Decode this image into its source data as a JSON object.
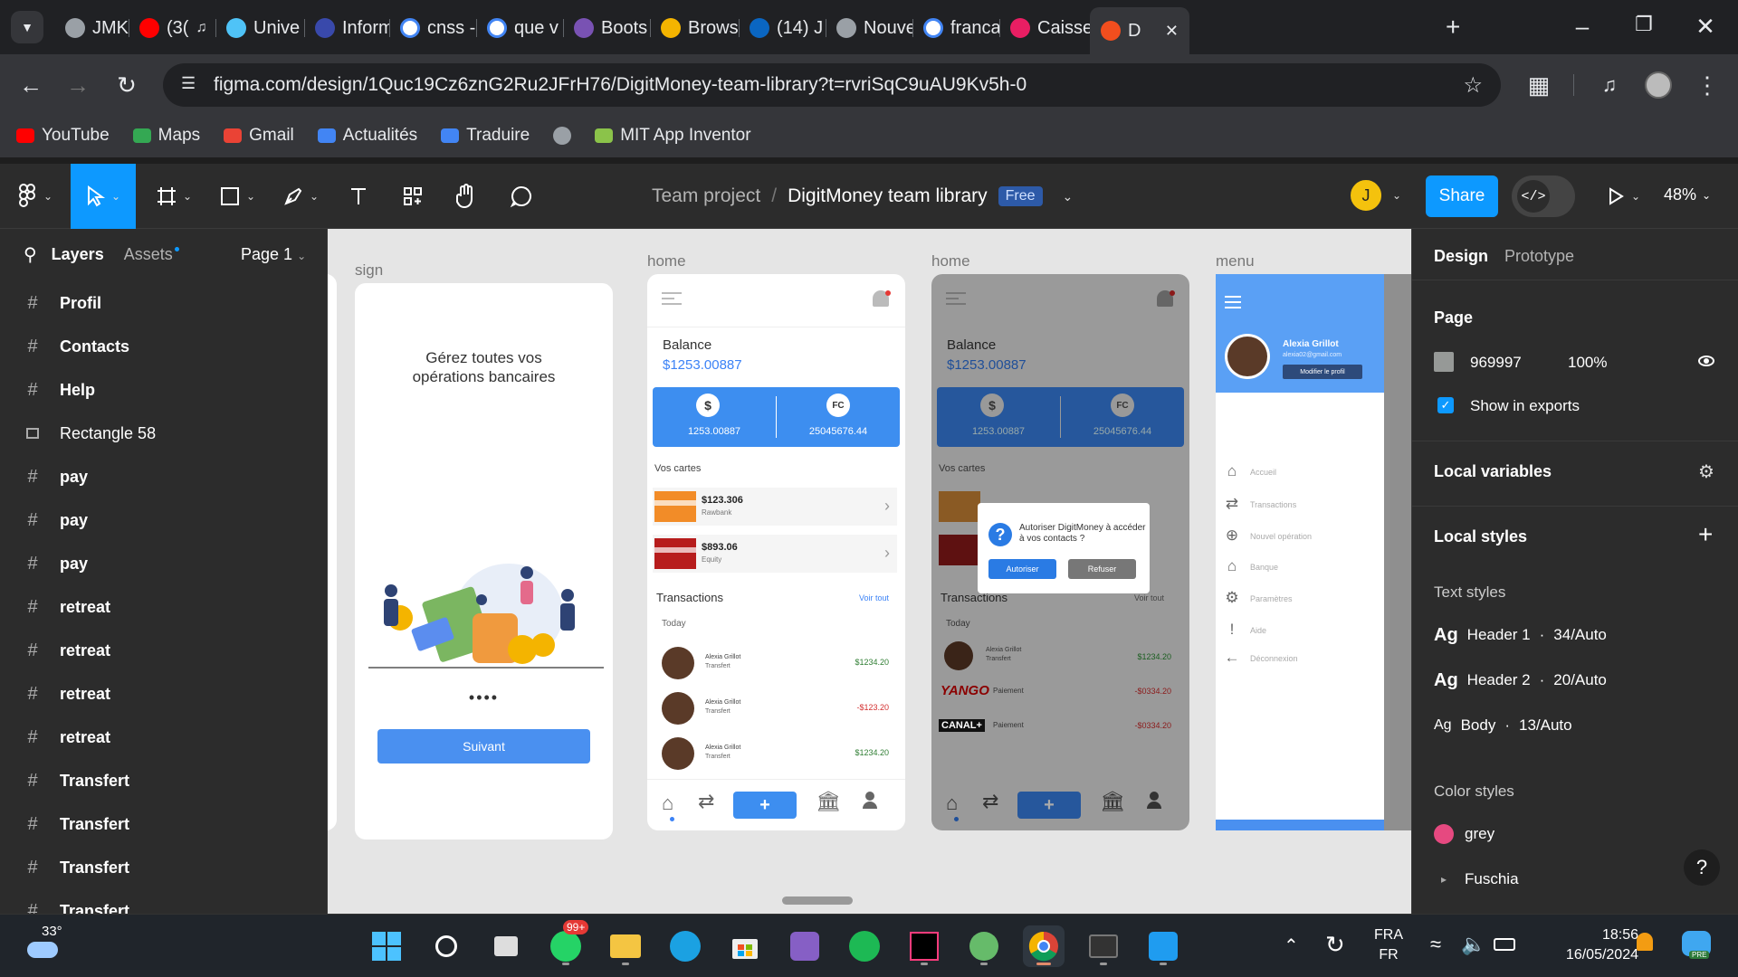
{
  "browser": {
    "tabs": [
      {
        "label": "JMK -",
        "icon": "globe-icon",
        "color": "#9aa0a6"
      },
      {
        "label": "(3(",
        "icon": "youtube-icon",
        "color": "#ff0000",
        "audio": true
      },
      {
        "label": "Unive",
        "icon": "globe-icon",
        "color": "#4fc3f7"
      },
      {
        "label": "Inform",
        "icon": "ze-icon",
        "color": "#3949ab"
      },
      {
        "label": "cnss -",
        "icon": "google-icon",
        "color": "#ffffff"
      },
      {
        "label": "que v",
        "icon": "google-icon",
        "color": "#ffffff"
      },
      {
        "label": "Boots",
        "icon": "bootstrap-icon",
        "color": "#7952b3"
      },
      {
        "label": "Brows",
        "icon": "browserstack-icon",
        "color": "#f4b400"
      },
      {
        "label": "(14) J",
        "icon": "linkedin-icon",
        "color": "#0a66c2"
      },
      {
        "label": "Nouve",
        "icon": "globe-icon",
        "color": "#9aa0a6"
      },
      {
        "label": "franca",
        "icon": "google-icon",
        "color": "#ffffff"
      },
      {
        "label": "Caisse",
        "icon": "app-icon",
        "color": "#e91e63"
      },
      {
        "label": "D",
        "icon": "figma-icon",
        "color": "#f24e1e",
        "active": true
      }
    ],
    "url": "figma.com/design/1Quc19Cz6znG2Ru2JFrH76/DigitMoney-team-library?t=rvriSqC9uAU9Kv5h-0",
    "bookmarks": [
      {
        "label": "YouTube",
        "color": "#ff0000"
      },
      {
        "label": "Maps",
        "color": "#34a853"
      },
      {
        "label": "Gmail",
        "color": "#ea4335"
      },
      {
        "label": "Actualités",
        "color": "#4285f4"
      },
      {
        "label": "Traduire",
        "color": "#4285f4"
      },
      {
        "label": "",
        "color": "#9aa0a6"
      },
      {
        "label": "MIT App Inventor",
        "color": "#8bc34a"
      }
    ]
  },
  "figma": {
    "breadcrumb_team": "Team project",
    "breadcrumb_sep": "/",
    "file_name": "DigitMoney team library",
    "plan_badge": "Free",
    "avatar_initial": "J",
    "share_label": "Share",
    "zoom": "48%",
    "left": {
      "tab_layers": "Layers",
      "tab_assets": "Assets",
      "page": "Page 1",
      "layers": [
        {
          "name": "Profil",
          "type": "frame"
        },
        {
          "name": "Contacts",
          "type": "frame"
        },
        {
          "name": "Help",
          "type": "frame"
        },
        {
          "name": "Rectangle 58",
          "type": "rect"
        },
        {
          "name": "pay",
          "type": "frame"
        },
        {
          "name": "pay",
          "type": "frame"
        },
        {
          "name": "pay",
          "type": "frame"
        },
        {
          "name": "retreat",
          "type": "frame"
        },
        {
          "name": "retreat",
          "type": "frame"
        },
        {
          "name": "retreat",
          "type": "frame"
        },
        {
          "name": "retreat",
          "type": "frame"
        },
        {
          "name": "Transfert",
          "type": "frame"
        },
        {
          "name": "Transfert",
          "type": "frame"
        },
        {
          "name": "Transfert",
          "type": "frame"
        },
        {
          "name": "Transfert",
          "type": "frame"
        }
      ]
    },
    "right": {
      "tab_design": "Design",
      "tab_prototype": "Prototype",
      "page_title": "Page",
      "page_color": "969997",
      "page_opacity": "100%",
      "show_exports": "Show in exports",
      "local_variables": "Local variables",
      "local_styles": "Local styles",
      "text_styles_title": "Text styles",
      "text_styles": [
        {
          "ag": "Ag",
          "name": "Header 1",
          "spec": "34/Auto"
        },
        {
          "ag": "Ag",
          "name": "Header 2",
          "spec": "20/Auto"
        },
        {
          "ag": "Ag",
          "name": "Body",
          "spec": "13/Auto"
        }
      ],
      "color_styles_title": "Color styles",
      "color_styles": [
        {
          "name": "grey",
          "color": "#e64980"
        },
        {
          "name": "Fuschia",
          "color": ""
        }
      ],
      "help": "?"
    }
  },
  "canvas": {
    "sign": {
      "label": "sign",
      "heading": "Gérez toutes vos opérations bancaires",
      "dots": "••••",
      "button": "Suivant"
    },
    "home": {
      "label": "home",
      "balance_label": "Balance",
      "balance_value": "$1253.00887",
      "currency_usd_symbol": "$",
      "currency_usd_value": "1253.00887",
      "currency_fc_symbol": "FC",
      "currency_fc_value": "25045676.44",
      "cards_title": "Vos cartes",
      "cards": [
        {
          "amount": "$123.306",
          "bank": "Rawbank",
          "color": "#f28c28"
        },
        {
          "amount": "$893.06",
          "bank": "Equity",
          "color": "#b71c1c"
        }
      ],
      "transactions_title": "Transactions",
      "see_all": "Voir tout",
      "today": "Today",
      "transactions": [
        {
          "name": "Alexia Grillot",
          "type": "Transfert",
          "amount": "$1234.20",
          "color": "#2e7d32"
        },
        {
          "name": "Alexia Grillot",
          "type": "Transfert",
          "amount": "-$123.20",
          "color": "#d32f2f"
        },
        {
          "name": "Alexia Grillot",
          "type": "Transfert",
          "amount": "$1234.20",
          "color": "#2e7d32"
        }
      ],
      "plus": "+"
    },
    "home2": {
      "label": "home",
      "dialog_text": "Autoriser DigitMoney à accéder à vos contacts ?",
      "dialog_allow": "Autoriser",
      "dialog_refuse": "Refuser",
      "transactions": [
        {
          "name": "Alexia Grillot",
          "type": "Transfert",
          "amount": "$1234.20"
        },
        {
          "name": "YANGO",
          "type": "Paiement",
          "amount": "-$0334.20"
        },
        {
          "name": "CANAL+",
          "type": "Paiement",
          "amount": "-$0334.20"
        }
      ]
    },
    "menu": {
      "label": "menu",
      "user_name": "Alexia Grillot",
      "user_email": "alexia02@gmail.com",
      "edit_profile": "Modifier le profil",
      "items": [
        {
          "label": "Accueil",
          "icon": "home-icon"
        },
        {
          "label": "Transactions",
          "icon": "transfer-icon"
        },
        {
          "label": "Nouvel opération",
          "icon": "plus-circle-icon"
        },
        {
          "label": "Banque",
          "icon": "bank-icon"
        },
        {
          "label": "Paramètres",
          "icon": "gear-icon"
        },
        {
          "label": "Aide",
          "icon": "exclamation-icon"
        },
        {
          "label": "Déconnexion",
          "icon": "logout-icon"
        }
      ]
    }
  },
  "taskbar": {
    "weather": "33°",
    "whatsapp_badge": "99+",
    "lang_top": "FRA",
    "lang_bottom": "FR",
    "time": "18:56",
    "date": "16/05/2024",
    "copilot_badge": "PRE"
  }
}
